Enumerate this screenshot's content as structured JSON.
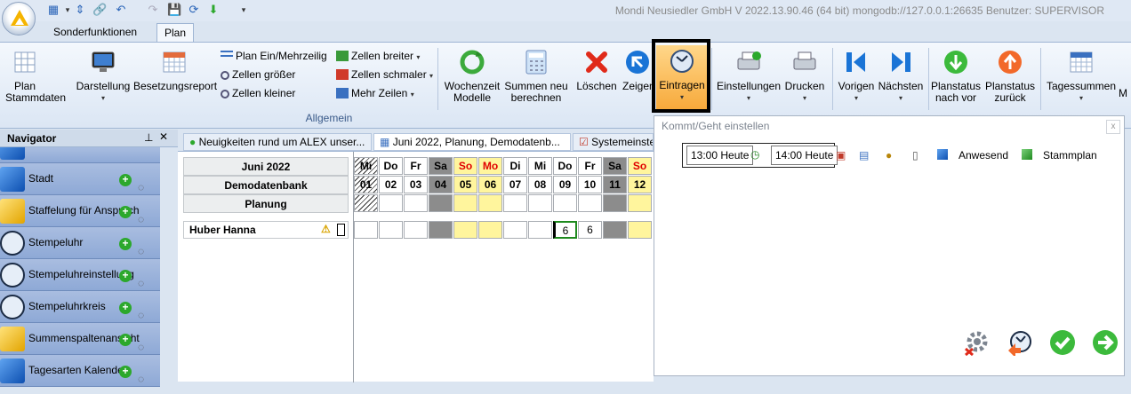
{
  "window": {
    "title": "Mondi Neusiedler GmbH V 2022.13.90.46 (64 bit) mongodb://127.0.0.1:26635 Benutzer: SUPERVISOR"
  },
  "ribbon_tabs": [
    {
      "label": "Sonderfunktionen"
    },
    {
      "label": "Plan"
    }
  ],
  "ribbon": {
    "plan_stammdaten": "Plan Stammdaten",
    "darstellung": "Darstellung",
    "besetzungsreport": "Besetzungsreport",
    "plan_ein_mehrzeilig": "Plan Ein/Mehrzeilig",
    "zellen_groesser": "Zellen größer",
    "zellen_kleiner": "Zellen kleiner",
    "zellen_breiter": "Zellen breiter",
    "zellen_schmaler": "Zellen schmaler",
    "mehr_zeilen": "Mehr Zeilen",
    "wochenzeit_modelle": "Wochenzeit Modelle",
    "summen_neu_berechnen": "Summen neu berechnen",
    "loeschen": "Löschen",
    "zeigen": "Zeigen",
    "eintragen": "Eintragen",
    "einstellungen": "Einstellungen",
    "drucken": "Drucken",
    "vorigen": "Vorigen",
    "naechsten": "Nächsten",
    "planstatus_nach_vor": "Planstatus nach vor",
    "planstatus_zurueck": "Planstatus zurück",
    "tagessummen": "Tagessummen",
    "group_allgemein": "Allgemein"
  },
  "navigator": {
    "title": "Navigator",
    "items": [
      {
        "label": "Stadt",
        "icon": "blue-cube-icon"
      },
      {
        "label": "Staffelung für Anspruch",
        "icon": "yellow-cube-icon"
      },
      {
        "label": "Stempeluhr",
        "icon": "clock-icon"
      },
      {
        "label": "Stempeluhreinstellung",
        "icon": "clock-sync-icon"
      },
      {
        "label": "Stempeluhrkreis",
        "icon": "clock-sync-icon"
      },
      {
        "label": "Summenspaltenansicht",
        "icon": "yellow-cube-icon"
      },
      {
        "label": "Tagesarten Kalender",
        "icon": "blue-cube-icon"
      }
    ]
  },
  "doc_tabs": [
    {
      "label": "Neuigkeiten rund um ALEX unser..."
    },
    {
      "label": "Juni 2022, Planung, Demodatenb..."
    },
    {
      "label": "Systemeinste"
    }
  ],
  "plan": {
    "month": "Juni 2022",
    "database": "Demodatenbank",
    "mode": "Planung",
    "weekdays": [
      "Mi",
      "Do",
      "Fr",
      "Sa",
      "So",
      "Mo",
      "Di",
      "Mi",
      "Do",
      "Fr",
      "Sa",
      "So"
    ],
    "days": [
      "01",
      "02",
      "03",
      "04",
      "05",
      "06",
      "07",
      "08",
      "09",
      "10",
      "11",
      "12"
    ],
    "employee": "Huber Hanna",
    "values": [
      "",
      "",
      "",
      "",
      "",
      "",
      "",
      "",
      "6",
      "6",
      "",
      ""
    ]
  },
  "dialog": {
    "title": "Kommt/Geht einstellen",
    "from": "13:00 Heute",
    "to": "14:00 Heute",
    "anwesend": "Anwesend",
    "stammplan": "Stammplan"
  }
}
